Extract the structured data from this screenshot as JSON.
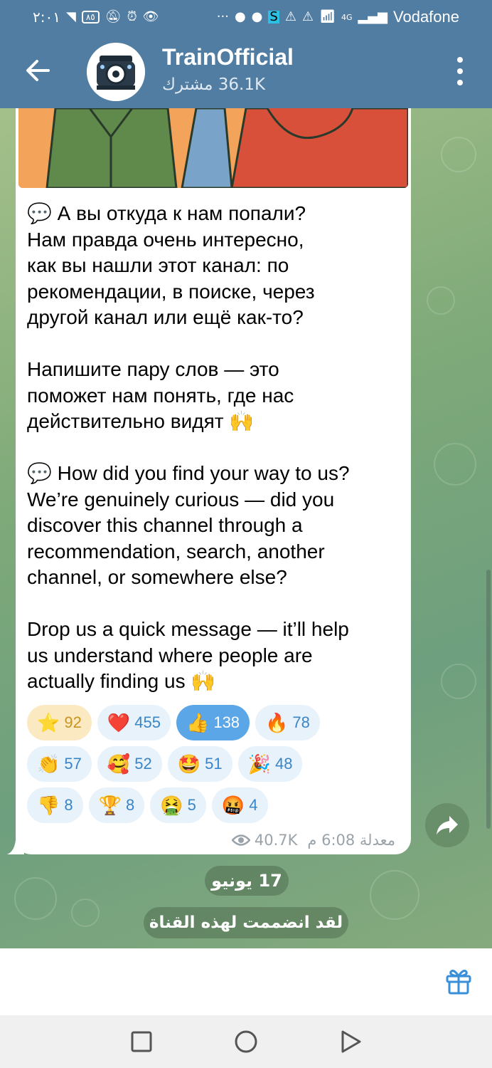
{
  "status_bar": {
    "time": "٢:٠١",
    "battery": "٨٥",
    "network": "4G",
    "carrier": "Vodafone"
  },
  "header": {
    "title": "TrainOfficial",
    "subtitle": "36.1K مشترك"
  },
  "message": {
    "text": "💬 А вы откуда к нам попали?\nНам правда очень интересно,\nкак вы нашли этот канал: по\nрекомендации, в поиске, через\nдругой канал или ещё как-то?\n\nНапишите пару слов — это\nпоможет нам понять, где нас\nдействительно видят 🙌\n\n💬 How did you find your way to us?\nWe’re genuinely curious — did you\ndiscover this channel through a\nrecommendation, search, another\nchannel, or somewhere else?\n\nDrop us a quick message — it’ll help\nus understand where people are\nactually finding us 🙌",
    "views": "40.7K",
    "time": "معدلة 6:08 م"
  },
  "reactions": [
    [
      {
        "emoji": "⭐",
        "count": "92",
        "kind": "star"
      },
      {
        "emoji": "❤️",
        "count": "455",
        "kind": "normal"
      },
      {
        "emoji": "👍",
        "count": "138",
        "kind": "active"
      },
      {
        "emoji": "🔥",
        "count": "78",
        "kind": "normal"
      }
    ],
    [
      {
        "emoji": "👏",
        "count": "57",
        "kind": "normal"
      },
      {
        "emoji": "🥰",
        "count": "52",
        "kind": "normal"
      },
      {
        "emoji": "🤩",
        "count": "51",
        "kind": "normal"
      },
      {
        "emoji": "🎉",
        "count": "48",
        "kind": "normal"
      }
    ],
    [
      {
        "emoji": "👎",
        "count": "8",
        "kind": "normal"
      },
      {
        "emoji": "🏆",
        "count": "8",
        "kind": "normal"
      },
      {
        "emoji": "🤮",
        "count": "5",
        "kind": "normal"
      },
      {
        "emoji": "🤬",
        "count": "4",
        "kind": "normal"
      }
    ]
  ],
  "date_chip": "17 يونيو",
  "service_message": "لقد انضممت لهذه القناة",
  "colors": {
    "header": "#517da2",
    "reaction_bg": "#e7f2fb",
    "reaction_text": "#3a85c6",
    "reaction_active": "#5aa6e6",
    "star_bg": "#fbe9c2"
  }
}
